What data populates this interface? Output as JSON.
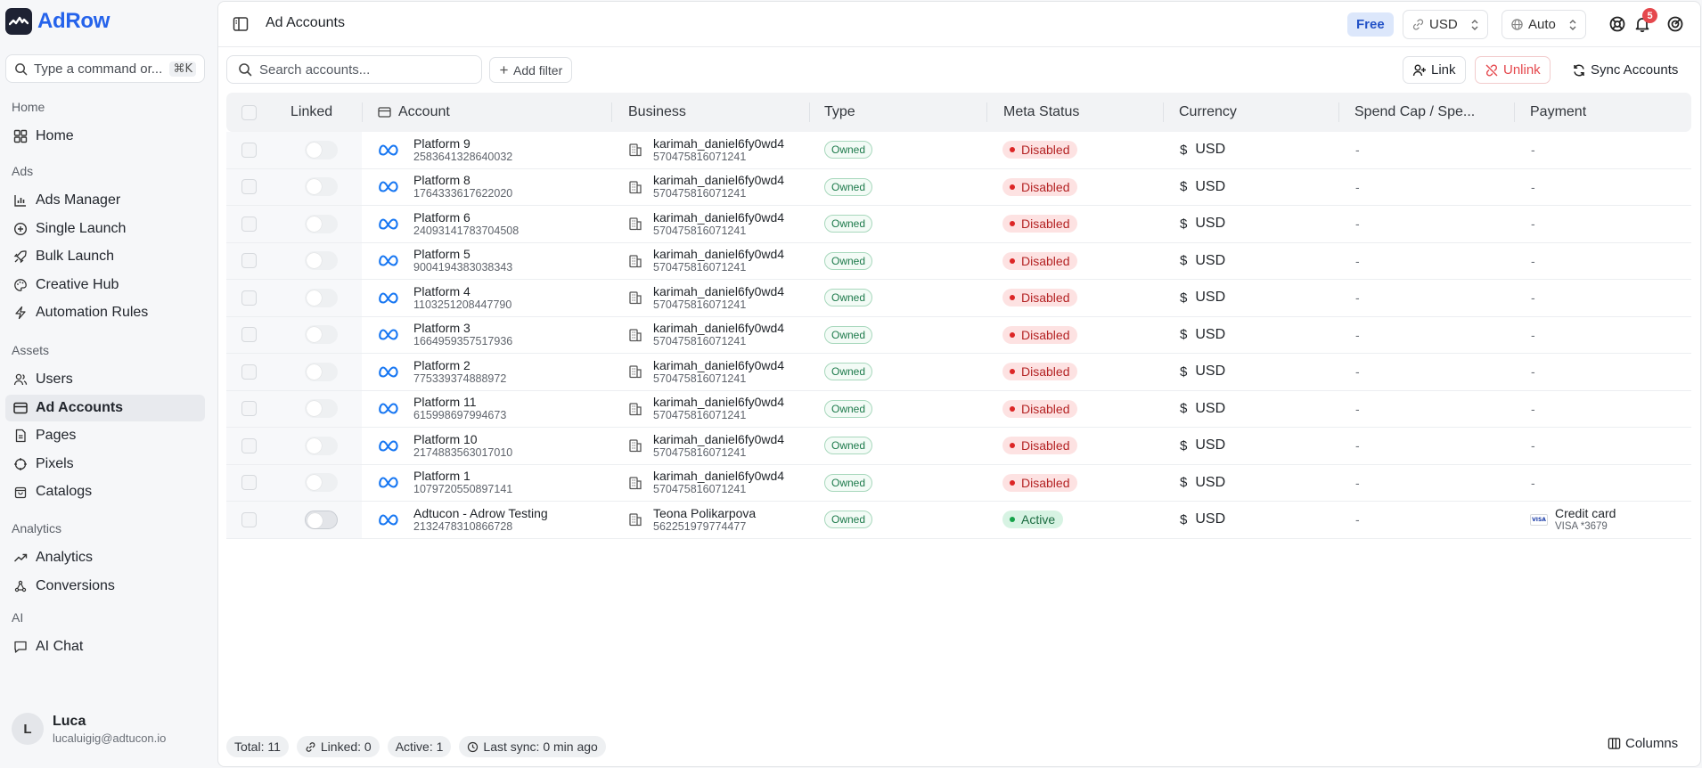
{
  "brand": {
    "name": "AdRow"
  },
  "command": {
    "placeholder": "Type a command or...",
    "shortcut": "⌘K"
  },
  "sidebar": {
    "groups": [
      {
        "title": "Home",
        "items": [
          {
            "label": "Home",
            "icon": "layout-grid-icon"
          }
        ]
      },
      {
        "title": "Ads",
        "items": [
          {
            "label": "Ads Manager",
            "icon": "bar-chart-icon"
          },
          {
            "label": "Single Launch",
            "icon": "plus-circle-icon"
          },
          {
            "label": "Bulk Launch",
            "icon": "rocket-icon"
          },
          {
            "label": "Creative Hub",
            "icon": "palette-icon"
          },
          {
            "label": "Automation Rules",
            "icon": "bolt-icon"
          }
        ]
      },
      {
        "title": "Assets",
        "items": [
          {
            "label": "Users",
            "icon": "users-icon"
          },
          {
            "label": "Ad Accounts",
            "icon": "credit-card-icon",
            "active": true
          },
          {
            "label": "Pages",
            "icon": "file-icon"
          },
          {
            "label": "Pixels",
            "icon": "target-icon"
          },
          {
            "label": "Catalogs",
            "icon": "shopping-bag-icon"
          }
        ]
      },
      {
        "title": "Analytics",
        "items": [
          {
            "label": "Analytics",
            "icon": "trending-up-icon"
          },
          {
            "label": "Conversions",
            "icon": "webhook-icon"
          }
        ]
      },
      {
        "title": "AI",
        "items": [
          {
            "label": "AI Chat",
            "icon": "message-square-icon"
          }
        ]
      }
    ]
  },
  "user": {
    "initial": "L",
    "name": "Luca",
    "email": "lucaluigig@adtucon.io"
  },
  "topbar": {
    "title": "Ad Accounts",
    "plan": "Free",
    "currency": "USD",
    "theme": "Auto",
    "notifications": "5"
  },
  "toolbar": {
    "search_placeholder": "Search accounts...",
    "add_filter": "Add filter",
    "link": "Link",
    "unlink": "Unlink",
    "sync": "Sync Accounts"
  },
  "table": {
    "columns": [
      "Linked",
      "Account",
      "Business",
      "Type",
      "Meta Status",
      "Currency",
      "Spend Cap / Spe...",
      "Payment"
    ],
    "rows": [
      {
        "name": "Platform 9",
        "id": "2583641328640032",
        "business": "karimah_daniel6fy0wd4",
        "business_id": "570475816071241",
        "type": "Owned",
        "status": "Disabled",
        "currency": "USD",
        "spend_cap": "-",
        "payment": "-",
        "payment_sub": ""
      },
      {
        "name": "Platform 8",
        "id": "1764333617622020",
        "business": "karimah_daniel6fy0wd4",
        "business_id": "570475816071241",
        "type": "Owned",
        "status": "Disabled",
        "currency": "USD",
        "spend_cap": "-",
        "payment": "-",
        "payment_sub": ""
      },
      {
        "name": "Platform 6",
        "id": "24093141783704508",
        "business": "karimah_daniel6fy0wd4",
        "business_id": "570475816071241",
        "type": "Owned",
        "status": "Disabled",
        "currency": "USD",
        "spend_cap": "-",
        "payment": "-",
        "payment_sub": ""
      },
      {
        "name": "Platform 5",
        "id": "9004194383038343",
        "business": "karimah_daniel6fy0wd4",
        "business_id": "570475816071241",
        "type": "Owned",
        "status": "Disabled",
        "currency": "USD",
        "spend_cap": "-",
        "payment": "-",
        "payment_sub": ""
      },
      {
        "name": "Platform 4",
        "id": "1103251208447790",
        "business": "karimah_daniel6fy0wd4",
        "business_id": "570475816071241",
        "type": "Owned",
        "status": "Disabled",
        "currency": "USD",
        "spend_cap": "-",
        "payment": "-",
        "payment_sub": ""
      },
      {
        "name": "Platform 3",
        "id": "1664959357517936",
        "business": "karimah_daniel6fy0wd4",
        "business_id": "570475816071241",
        "type": "Owned",
        "status": "Disabled",
        "currency": "USD",
        "spend_cap": "-",
        "payment": "-",
        "payment_sub": ""
      },
      {
        "name": "Platform 2",
        "id": "775339374888972",
        "business": "karimah_daniel6fy0wd4",
        "business_id": "570475816071241",
        "type": "Owned",
        "status": "Disabled",
        "currency": "USD",
        "spend_cap": "-",
        "payment": "-",
        "payment_sub": ""
      },
      {
        "name": "Platform 11",
        "id": "615998697994673",
        "business": "karimah_daniel6fy0wd4",
        "business_id": "570475816071241",
        "type": "Owned",
        "status": "Disabled",
        "currency": "USD",
        "spend_cap": "-",
        "payment": "-",
        "payment_sub": ""
      },
      {
        "name": "Platform 10",
        "id": "2174883563017010",
        "business": "karimah_daniel6fy0wd4",
        "business_id": "570475816071241",
        "type": "Owned",
        "status": "Disabled",
        "currency": "USD",
        "spend_cap": "-",
        "payment": "-",
        "payment_sub": ""
      },
      {
        "name": "Platform 1",
        "id": "1079720550897141",
        "business": "karimah_daniel6fy0wd4",
        "business_id": "570475816071241",
        "type": "Owned",
        "status": "Disabled",
        "currency": "USD",
        "spend_cap": "-",
        "payment": "-",
        "payment_sub": ""
      },
      {
        "name": "Adtucon - Adrow Testing",
        "id": "2132478310866728",
        "business": "Teona Polikarpova",
        "business_id": "562251979774477",
        "type": "Owned",
        "status": "Active",
        "currency": "USD",
        "spend_cap": "-",
        "payment": "Credit card",
        "payment_sub": "VISA *3679"
      }
    ]
  },
  "footer": {
    "total": "Total: 11",
    "linked": "Linked: 0",
    "active": "Active: 1",
    "last_sync": "Last sync: 0 min ago",
    "columns": "Columns"
  },
  "colors": {
    "accent": "#2563eb",
    "danger": "#e5484d",
    "success": "#16a34a",
    "meta": "#1877f2"
  }
}
